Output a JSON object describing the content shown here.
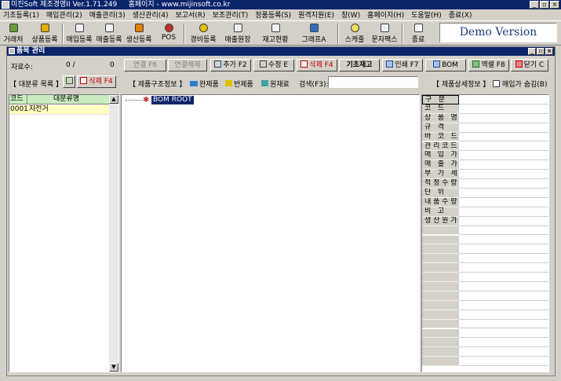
{
  "app": {
    "title": "미진Soft 제조경영II Ver.1.71.249     홈페이지 - www.mijinsoft.co.kr",
    "window_buttons": [
      "_",
      "▫",
      "×"
    ]
  },
  "menu": [
    "기초등록(1)",
    "매입관리(2)",
    "매출관리(3)",
    "생산관리(4)",
    "보고서(R)",
    "보조관리(T)",
    "정품등록(S)",
    "원격지원(E)",
    "창(W)",
    "홈페이지(H)",
    "도움말(H)",
    "종료(X)"
  ],
  "toolbar": [
    "거래처",
    "상품등록",
    "매입등록",
    "매출등록",
    "생산등록",
    "POS",
    "경비등록",
    "매출원장",
    "재고현황",
    "그래프A",
    "스케줄",
    "문자팩스",
    "종료"
  ],
  "demo": "Demo Version",
  "child": {
    "title": "품목 관리",
    "buttons": [
      "_",
      "▫",
      "×"
    ]
  },
  "row1": {
    "count_label": "자료수:",
    "count_value": "0 /",
    "count_total": "0",
    "link_btn": "연결 F6",
    "unlink_btn": "연결해제",
    "add_btn": "추가 F2",
    "edit_btn": "수정 E",
    "del_btn": "삭제 F4",
    "base_stock": "기초재고",
    "print_btn": "인쇄 F7",
    "bom_btn": "BOM",
    "excel_btn": "엑셀 F8",
    "close_btn": "닫기 C"
  },
  "row2": {
    "cat_label": "【 대분류 목록 】",
    "cat_del": "삭제 F4",
    "struct_label": "【 제품구조정보 】",
    "finished": "완제품",
    "semi": "반제품",
    "raw": "원재료",
    "search_label": "검색(F3):",
    "search_value": "",
    "detail_label": "【 제품상세정보 】",
    "hide_price": "매입가 숨김(B)"
  },
  "category": {
    "headers": [
      "코드",
      "대분류명"
    ],
    "rows": [
      {
        "code": "0001",
        "name": "자전거"
      }
    ]
  },
  "tree": {
    "root": "BOM ROOT"
  },
  "detail_labels": [
    "구 분",
    "코 드",
    "상 품 명",
    "규 격",
    "바 코 드",
    "관리코드",
    "매 입 가",
    "매 출 가",
    "부 가 세",
    "적정수량",
    "단 위",
    "내품수량",
    "비 고",
    "생산원가"
  ],
  "colors": {
    "title": "#0a246a",
    "grid_header": "#c8ecc0",
    "selected_row": "#ffffc0"
  }
}
